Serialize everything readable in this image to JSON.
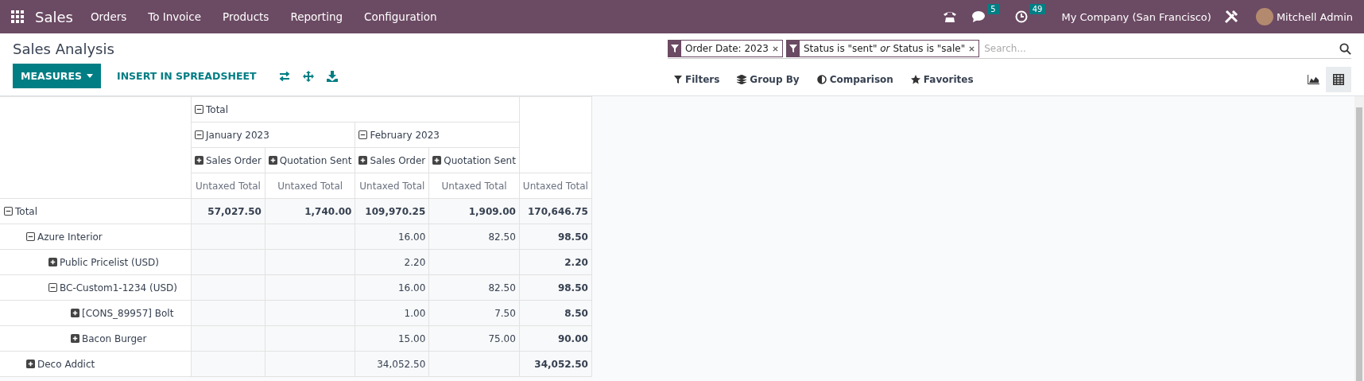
{
  "navbar": {
    "app": "Sales",
    "menu": [
      "Orders",
      "To Invoice",
      "Products",
      "Reporting",
      "Configuration"
    ],
    "messages_badge": "5",
    "activities_badge": "49",
    "company": "My Company (San Francisco)",
    "user": "Mitchell Admin"
  },
  "title": "Sales Analysis",
  "toolbar": {
    "measures": "MEASURES",
    "insert": "INSERT IN SPREADSHEET"
  },
  "search": {
    "facets": [
      {
        "parts": [
          "Order Date: 2023"
        ]
      },
      {
        "parts": [
          "Status is \"sent\"",
          "Status is \"sale\""
        ],
        "joiner": "or"
      }
    ],
    "placeholder": "Search..."
  },
  "filter_menu": [
    "Filters",
    "Group By",
    "Comparison",
    "Favorites"
  ],
  "views": [
    {
      "kind": "graph",
      "selected": false
    },
    {
      "kind": "pivot",
      "selected": true
    }
  ],
  "columns": {
    "label": "Total",
    "expanded": true,
    "children": [
      {
        "label": "January 2023",
        "expanded": true,
        "children": [
          {
            "label": "Sales Order",
            "expanded": false
          },
          {
            "label": "Quotation Sent",
            "expanded": false
          }
        ]
      },
      {
        "label": "February 2023",
        "expanded": true,
        "children": [
          {
            "label": "Sales Order",
            "expanded": false
          },
          {
            "label": "Quotation Sent",
            "expanded": false
          }
        ]
      }
    ]
  },
  "measure_headers": [
    "Untaxed Total",
    "Untaxed Total",
    "Untaxed Total",
    "Untaxed Total",
    "Untaxed Total"
  ],
  "rows": [
    {
      "label": "Total",
      "expanded": true,
      "values": {
        "jan_sales_order": "57,027.50",
        "jan_quotation_sent": "1,740.00",
        "feb_sales_order": "109,970.25",
        "feb_quotation_sent": "1,909.00",
        "total": "170,646.75"
      },
      "children": [
        {
          "label": "Azure Interior",
          "expanded": true,
          "values": {
            "feb_sales_order": "16.00",
            "feb_quotation_sent": "82.50",
            "total": "98.50"
          },
          "children": [
            {
              "label": "Public Pricelist (USD)",
              "expanded": false,
              "values": {
                "feb_sales_order": "2.20",
                "total": "2.20"
              }
            },
            {
              "label": "BC-Custom1-1234 (USD)",
              "expanded": true,
              "values": {
                "feb_sales_order": "16.00",
                "feb_quotation_sent": "82.50",
                "total": "98.50"
              },
              "children": [
                {
                  "label": "[CONS_89957] Bolt",
                  "expanded": false,
                  "values": {
                    "feb_sales_order": "1.00",
                    "feb_quotation_sent": "7.50",
                    "total": "8.50"
                  }
                },
                {
                  "label": "Bacon Burger",
                  "expanded": false,
                  "values": {
                    "feb_sales_order": "15.00",
                    "feb_quotation_sent": "75.00",
                    "total": "90.00"
                  }
                }
              ]
            }
          ]
        },
        {
          "label": "Deco Addict",
          "expanded": false,
          "values": {
            "feb_sales_order": "34,052.50",
            "total": "34,052.50"
          }
        }
      ]
    }
  ]
}
